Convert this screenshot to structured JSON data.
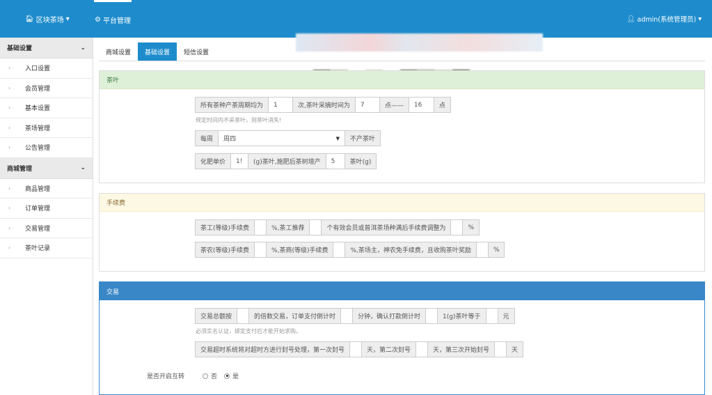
{
  "header": {
    "brand": "区块茶场",
    "platform": "平台管理",
    "user": "admin(系统管理员)",
    "colors": {
      "navbar": "#1e8ccc"
    }
  },
  "sidebar": {
    "groups": [
      {
        "label": "基础设置",
        "items": [
          "入口设置",
          "会员管理",
          "基本设置",
          "茶场管理",
          "公告管理"
        ]
      },
      {
        "label": "商城管理",
        "items": [
          "商品管理",
          "订单管理",
          "交易管理",
          "茶叶记录"
        ]
      }
    ]
  },
  "tabs": [
    "商城设置",
    "基础设置",
    "短信设置"
  ],
  "active_tab": "基础设置",
  "tea": {
    "title": "茶叶",
    "row1": {
      "a": "所有茶种产茶周期均为",
      "v1": "1",
      "b": "次,茶叶采摘时间为",
      "v2": "7",
      "c": "点——",
      "v3": "16",
      "d": "点"
    },
    "hint1": "规定时间内不采茶叶，则茶叶消失!",
    "row2": {
      "a": "每周",
      "select": "周四",
      "b": "不产茶叶"
    },
    "row3": {
      "a": "化肥单价",
      "v1": "1!",
      "b": "(g)茶叶,施肥后茶树增产",
      "v2": "5",
      "c": "茶叶(g)"
    }
  },
  "fee": {
    "title": "手续费",
    "row1": {
      "a": "茶工(等级)手续费",
      "v1": "",
      "b": "%,茶工推荐",
      "v2": "",
      "c": "个有效会员或普洱茶场种满后手续费调整为",
      "v3": "",
      "d": "%"
    },
    "row2": {
      "a": "茶农(等级)手续费",
      "v1": "",
      "b": "%,茶商(等级)手续费",
      "v2": "",
      "c": "%,茶场主，神农免手续费，且收购茶叶奖励",
      "v3": "",
      "d": "%"
    }
  },
  "trade": {
    "title": "交易",
    "row1": {
      "a": "交易总额按",
      "v1": "",
      "b": "的倍数交易，订单支付倒计时",
      "v2": "",
      "c": "分钟，确认打款倒计时",
      "v3": "",
      "d": "1(g)茶叶等于",
      "v4": "",
      "e": "元"
    },
    "hint": "必须实名认证，绑定支付后才能开始求购。",
    "row2": {
      "a": "交易超时系统将对超时方进行封号处理，第一次封号",
      "v1": "",
      "b": "天，第二次封号",
      "v2": "",
      "c": "天，第三次开始封号",
      "v3": "",
      "d": "天"
    },
    "mutual_label": "是否开启互转",
    "opt_no": "否",
    "opt_yes": "是",
    "selected": "是"
  }
}
